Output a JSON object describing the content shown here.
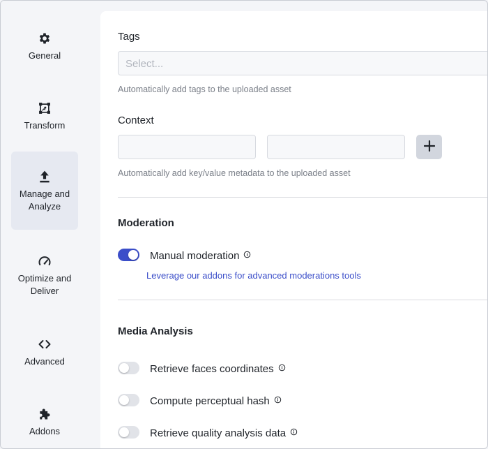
{
  "sidebar": {
    "items": [
      {
        "label": "General",
        "icon": "gear-icon",
        "active": false
      },
      {
        "label": "Transform",
        "icon": "transform-icon",
        "active": false
      },
      {
        "label": "Manage and\nAnalyze",
        "icon": "upload-icon",
        "active": true
      },
      {
        "label": "Optimize and\nDeliver",
        "icon": "gauge-icon",
        "active": false
      },
      {
        "label": "Advanced",
        "icon": "code-icon",
        "active": false
      },
      {
        "label": "Addons",
        "icon": "puzzle-icon",
        "active": false
      }
    ]
  },
  "tags": {
    "label": "Tags",
    "placeholder": "Select...",
    "help": "Automatically add tags to the uploaded asset"
  },
  "context": {
    "label": "Context",
    "key_value": "",
    "value_value": "",
    "add_icon": "plus-icon",
    "help": "Automatically add key/value metadata to the uploaded asset"
  },
  "moderation": {
    "title": "Moderation",
    "manual_label": "Manual moderation",
    "manual_on": true,
    "addons_link": "Leverage our addons for advanced moderations tools"
  },
  "media_analysis": {
    "title": "Media Analysis",
    "options": [
      {
        "label": "Retrieve faces coordinates",
        "on": false
      },
      {
        "label": "Compute perceptual hash",
        "on": false
      },
      {
        "label": "Retrieve quality analysis data",
        "on": false
      }
    ]
  },
  "colors": {
    "accent": "#3b4ec9",
    "toggle_off": "#e1e3e8",
    "sidebar_bg": "#f4f5f8",
    "active_item_bg": "#e6e9f1"
  }
}
